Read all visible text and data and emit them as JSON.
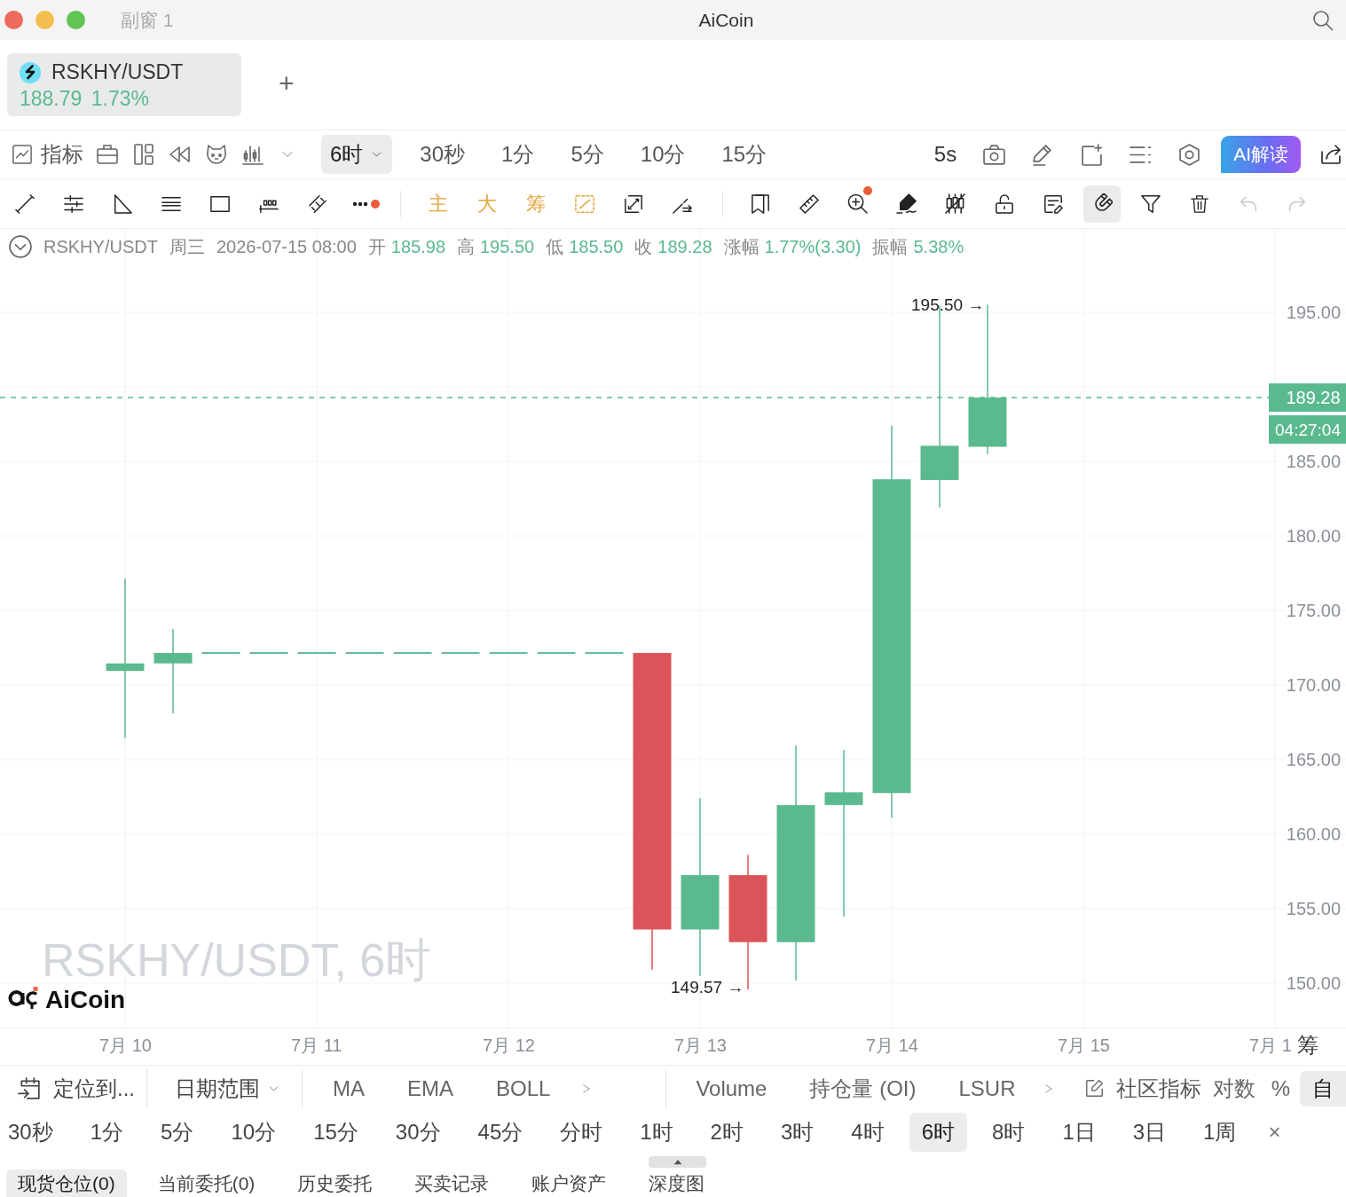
{
  "window": {
    "title": "AiCoin",
    "subtitle": "副窗 1"
  },
  "symbol_tabs": [
    {
      "pair": "RSKHY/USDT",
      "price": "188.79",
      "change": "1.73%",
      "selected": true
    }
  ],
  "add_tab": "+",
  "toolbar": {
    "indicators": "指标",
    "interval_dropdown": "6时",
    "quick_intervals": [
      {
        "label": "30秒",
        "selected": false
      },
      {
        "label": "1分",
        "selected": false
      },
      {
        "label": "5分",
        "selected": false
      },
      {
        "label": "10分",
        "selected": false
      },
      {
        "label": "15分",
        "selected": false
      }
    ],
    "refresh_rate": "5s",
    "ai_button": "AI解读"
  },
  "drawing_toolbar": {
    "overlay_buttons": [
      "主",
      "大",
      "筹"
    ],
    "more_tools_dot": true,
    "zoom_dot": true,
    "magnet_on": true,
    "undo_disabled": true,
    "redo_disabled": true
  },
  "info_bar": {
    "pair": "RSKHY/USDT",
    "weekday": "周三",
    "datetime": "2026-07-15 08:00",
    "fields": [
      {
        "label": "开",
        "value": "185.98"
      },
      {
        "label": "高",
        "value": "195.50"
      },
      {
        "label": "低",
        "value": "185.50"
      },
      {
        "label": "收",
        "value": "189.28"
      },
      {
        "label": "涨幅",
        "value": "1.77%(3.30)"
      },
      {
        "label": "振幅",
        "value": "5.38%"
      }
    ]
  },
  "chart": {
    "watermark": "RSKHY/USDT, 6时",
    "logo_text": "AiCoin",
    "price_axis": [
      "195.00",
      "185.00",
      "180.00",
      "175.00",
      "170.00",
      "165.00",
      "160.00",
      "155.00",
      "150.00"
    ],
    "last_price": "189.28",
    "countdown": "04:27:04",
    "high_marker": "195.50 →",
    "low_marker": "149.57 →",
    "time_axis": [
      "7月 10",
      "7月 11",
      "7月 12",
      "7月 13",
      "7月 14",
      "7月 15",
      "7月 1"
    ],
    "side_tabs": [
      "筹"
    ]
  },
  "indicator_bar": {
    "locate": "定位到...",
    "date_range": "日期范围",
    "main_indicators": [
      "MA",
      "EMA",
      "BOLL"
    ],
    "sub_indicators": [
      "Volume",
      "持仓量 (OI)",
      "LSUR"
    ],
    "community": "社区指标",
    "scale_modes": [
      {
        "label": "对数",
        "selected": false
      },
      {
        "label": "%",
        "selected": false
      },
      {
        "label": "自",
        "selected": true
      }
    ]
  },
  "interval_bar": {
    "intervals": [
      {
        "label": "30秒",
        "selected": false
      },
      {
        "label": "1分",
        "selected": false
      },
      {
        "label": "5分",
        "selected": false
      },
      {
        "label": "10分",
        "selected": false
      },
      {
        "label": "15分",
        "selected": false
      },
      {
        "label": "30分",
        "selected": false
      },
      {
        "label": "45分",
        "selected": false
      },
      {
        "label": "分时",
        "selected": false
      },
      {
        "label": "1时",
        "selected": false
      },
      {
        "label": "2时",
        "selected": false
      },
      {
        "label": "3时",
        "selected": false
      },
      {
        "label": "4时",
        "selected": false
      },
      {
        "label": "6时",
        "selected": true
      },
      {
        "label": "8时",
        "selected": false
      },
      {
        "label": "1日",
        "selected": false
      },
      {
        "label": "3日",
        "selected": false
      },
      {
        "label": "1周",
        "selected": false
      }
    ],
    "close": "×"
  },
  "account_tabs": [
    {
      "label": "现货仓位(0)",
      "selected": true
    },
    {
      "label": "当前委托(0)",
      "selected": false
    },
    {
      "label": "历史委托",
      "selected": false
    },
    {
      "label": "买卖记录",
      "selected": false
    },
    {
      "label": "账户资产",
      "selected": false
    },
    {
      "label": "深度图",
      "selected": false
    }
  ]
}
